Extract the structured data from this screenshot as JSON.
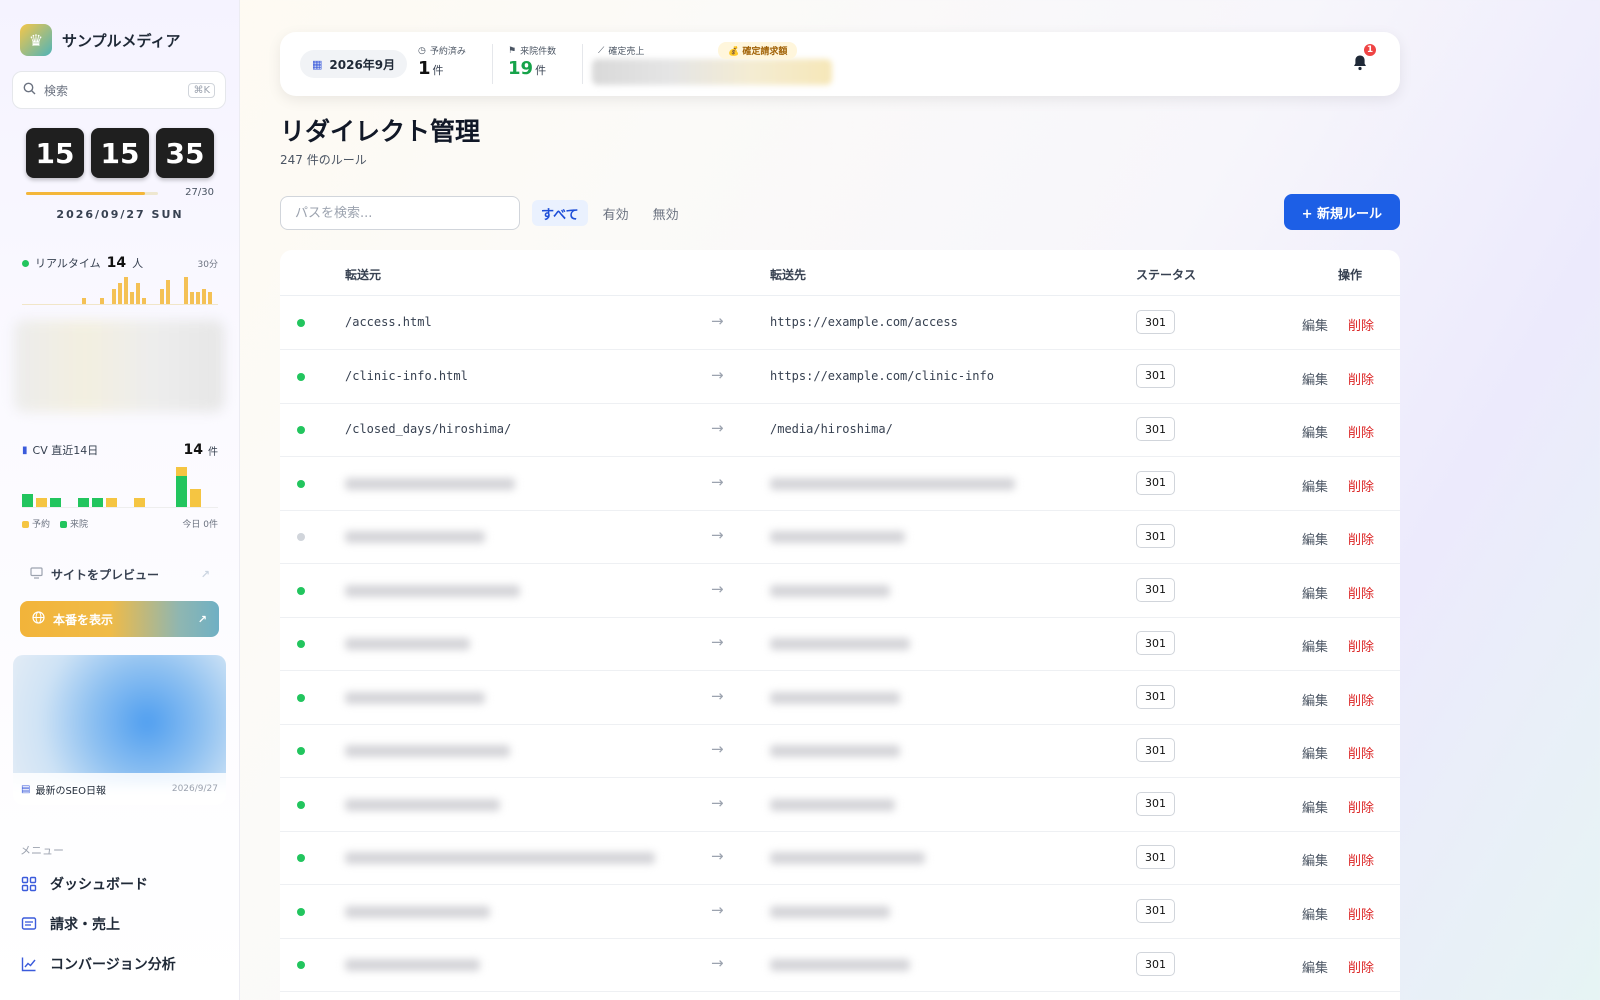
{
  "brand": {
    "name": "サンプルメディア"
  },
  "sidebar_search": {
    "placeholder": "検索",
    "shortcut": "⌘K"
  },
  "clock": {
    "hours": "15",
    "minutes": "15",
    "seconds": "35"
  },
  "month_progress": {
    "label": "27/30",
    "day": 27,
    "total": 30
  },
  "date_label": "2026/09/27 SUN",
  "realtime": {
    "label": "リアルタイム",
    "count": "14",
    "unit": "人",
    "period": "30分",
    "bars": [
      0,
      0,
      0,
      0,
      0,
      0,
      0,
      0,
      0,
      0,
      2,
      0,
      0,
      2,
      0,
      5,
      7,
      9,
      4,
      7,
      2,
      0,
      0,
      5,
      8,
      0,
      0,
      9,
      4,
      4,
      5,
      4,
      0
    ]
  },
  "cv": {
    "label": "CV 直近14日",
    "count": "14",
    "unit": "件",
    "legend_reserve": "予約",
    "legend_visit": "来院",
    "today": "今日 0件",
    "days": [
      {
        "reserve": 0,
        "visit": 3
      },
      {
        "reserve": 2,
        "visit": 0
      },
      {
        "reserve": 0,
        "visit": 2
      },
      {
        "reserve": 0,
        "visit": 0
      },
      {
        "reserve": 0,
        "visit": 2
      },
      {
        "reserve": 0,
        "visit": 2
      },
      {
        "reserve": 2,
        "visit": 0
      },
      {
        "reserve": 0,
        "visit": 0
      },
      {
        "reserve": 2,
        "visit": 0
      },
      {
        "reserve": 0,
        "visit": 0
      },
      {
        "reserve": 0,
        "visit": 0
      },
      {
        "reserve": 2,
        "visit": 7
      },
      {
        "reserve": 4,
        "visit": 0
      },
      {
        "reserve": 0,
        "visit": 0
      }
    ]
  },
  "links": {
    "preview": "サイトをプレビュー",
    "production": "本番を表示"
  },
  "seo": {
    "title": "最新のSEO日報",
    "date": "2026/9/27"
  },
  "menu": {
    "heading": "メニュー",
    "items": [
      {
        "label": "ダッシュボード",
        "icon": "grid-icon"
      },
      {
        "label": "請求・売上",
        "icon": "invoice-icon"
      },
      {
        "label": "コンバージョン分析",
        "icon": "chart-line-icon"
      }
    ]
  },
  "kpi": {
    "month": "2026年9月",
    "reserved_label": "予約済み",
    "reserved_value": "1",
    "reserved_unit": "件",
    "visits_label": "来院件数",
    "visits_value": "19",
    "visits_unit": "件",
    "sales_label": "確定売上",
    "billing_label": "確定請求額",
    "notifications": "1"
  },
  "page": {
    "title": "リダイレクト管理",
    "subtitle": "247 件のルール"
  },
  "filters": {
    "search_placeholder": "パスを検索...",
    "tabs": [
      "すべて",
      "有効",
      "無効"
    ],
    "new_rule": "+ 新規ルール"
  },
  "table": {
    "headers": {
      "source": "転送元",
      "destination": "転送先",
      "status": "ステータス",
      "actions": "操作"
    },
    "edit_label": "編集",
    "delete_label": "削除",
    "rows": [
      {
        "active": true,
        "source": "/access.html",
        "destination": "https://example.com/access",
        "code": "301"
      },
      {
        "active": true,
        "source": "/clinic-info.html",
        "destination": "https://example.com/clinic-info",
        "code": "301"
      },
      {
        "active": true,
        "source": "/closed_days/hiroshima/",
        "destination": "/media/hiroshima/",
        "code": "301"
      },
      {
        "active": true,
        "source": "",
        "destination": "",
        "code": "301"
      },
      {
        "active": false,
        "source": "",
        "destination": "",
        "code": "301"
      },
      {
        "active": true,
        "source": "",
        "destination": "",
        "code": "301"
      },
      {
        "active": true,
        "source": "",
        "destination": "",
        "code": "301"
      },
      {
        "active": true,
        "source": "",
        "destination": "",
        "code": "301"
      },
      {
        "active": true,
        "source": "",
        "destination": "",
        "code": "301"
      },
      {
        "active": true,
        "source": "",
        "destination": "",
        "code": "301"
      },
      {
        "active": true,
        "source": "",
        "destination": "",
        "code": "301"
      },
      {
        "active": true,
        "source": "",
        "destination": "",
        "code": "301"
      },
      {
        "active": true,
        "source": "",
        "destination": "",
        "code": "301"
      }
    ]
  }
}
